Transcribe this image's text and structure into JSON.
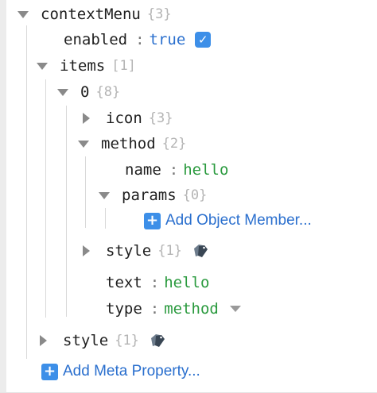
{
  "tree": {
    "root": {
      "key": "contextMenu",
      "count": "{3}"
    },
    "enabled": {
      "key": "enabled",
      "value": "true",
      "checked": true
    },
    "items": {
      "key": "items",
      "count": "[1]"
    },
    "item0": {
      "key": "0",
      "count": "{8}"
    },
    "icon": {
      "key": "icon",
      "count": "{3}"
    },
    "method": {
      "key": "method",
      "count": "{2}"
    },
    "method_name": {
      "key": "name",
      "value": "hello"
    },
    "params": {
      "key": "params",
      "count": "{0}"
    },
    "add_object_member": {
      "label": "Add Object Member..."
    },
    "item_style": {
      "key": "style",
      "count": "{1}"
    },
    "text": {
      "key": "text",
      "value": "hello"
    },
    "type": {
      "key": "type",
      "value": "method"
    },
    "root_style": {
      "key": "style",
      "count": "{1}"
    },
    "add_meta_property": {
      "label": "Add Meta Property..."
    }
  },
  "colors": {
    "accent": "#3d8fe8",
    "string_value": "#2a9a3e",
    "bool_value": "#2a6fce",
    "count": "#b4b4b4"
  },
  "icons": {
    "expanded": "triangle-down-icon",
    "collapsed": "triangle-right-icon",
    "checkbox": "checkbox-checked-icon",
    "tag": "tag-icon",
    "add": "plus-icon",
    "dropdown": "dropdown-arrow-icon"
  }
}
